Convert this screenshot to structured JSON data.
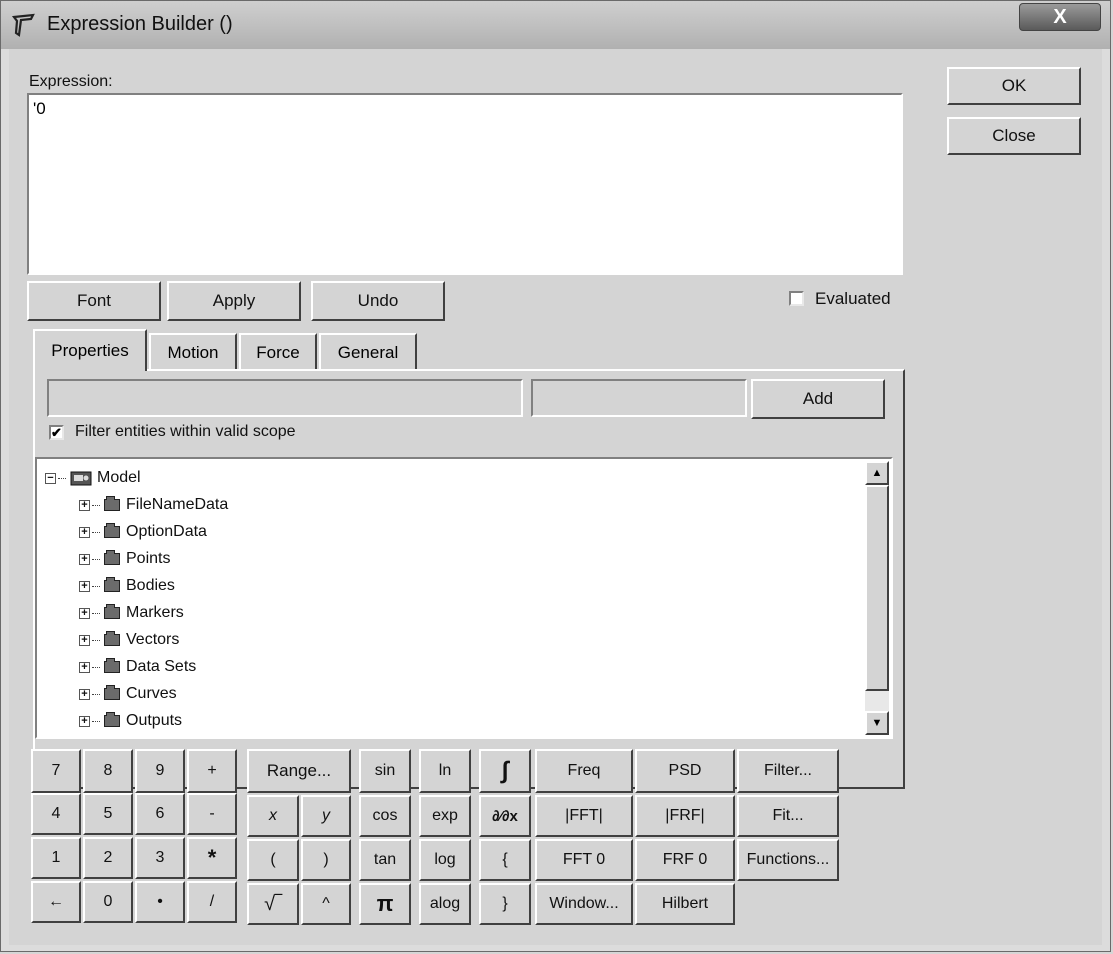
{
  "window": {
    "title": "Expression Builder ()",
    "close_symbol": "X"
  },
  "expression": {
    "label": "Expression:",
    "value": "'0"
  },
  "buttons": {
    "ok": "OK",
    "close": "Close",
    "font": "Font",
    "apply": "Apply",
    "undo": "Undo",
    "add": "Add"
  },
  "evaluated": {
    "label": "Evaluated",
    "checked": false
  },
  "tabs": [
    "Properties",
    "Motion",
    "Force",
    "General"
  ],
  "filter": {
    "label": "Filter entities within valid scope",
    "checked": true,
    "check_mark": "✔"
  },
  "tree": {
    "root": "Model",
    "items": [
      "FileNameData",
      "OptionData",
      "Points",
      "Bodies",
      "Markers",
      "Vectors",
      "Data Sets",
      "Curves",
      "Outputs"
    ]
  },
  "keypad": {
    "rows": [
      [
        "7",
        "8",
        "9",
        "+"
      ],
      [
        "4",
        "5",
        "6",
        "-"
      ],
      [
        "1",
        "2",
        "3",
        "*"
      ],
      [
        "←",
        "0",
        "•",
        "/"
      ]
    ]
  },
  "ops": {
    "range": "Range...",
    "x": "x",
    "y": "y",
    "lparen": "(",
    "rparen": ")",
    "sqrt": "√‾",
    "caret": "^",
    "sin": "sin",
    "cos": "cos",
    "tan": "tan",
    "pi": "π",
    "ln": "ln",
    "exp": "exp",
    "log": "log",
    "alog": "alog",
    "integral": "∫",
    "derivative": "∂⁄∂x",
    "lbrace": "{",
    "rbrace": "}",
    "freq": "Freq",
    "psd": "PSD",
    "filter": "Filter...",
    "fft_abs": "|FFT|",
    "frf_abs": "|FRF|",
    "fit": "Fit...",
    "fft0": "FFT 0",
    "frf0": "FRF 0",
    "functions": "Functions...",
    "window": "Window...",
    "hilbert": "Hilbert"
  }
}
